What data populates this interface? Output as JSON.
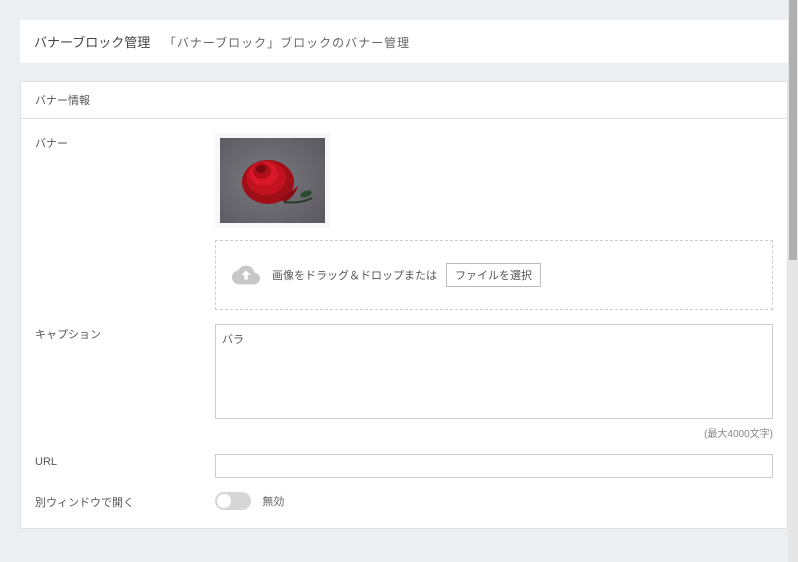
{
  "header": {
    "title": "バナーブロック管理",
    "sub": "「バナーブロック」ブロックのバナー管理"
  },
  "panel": {
    "title": "バナー情報"
  },
  "labels": {
    "banner": "バナー",
    "caption": "キャプション",
    "url": "URL",
    "newwindow": "別ウィンドウで開く"
  },
  "dropzone": {
    "text": "画像をドラッグ＆ドロップまたは",
    "button": "ファイルを選択"
  },
  "caption": {
    "value": "バラ",
    "hint": "(最大4000文字)"
  },
  "url": {
    "value": ""
  },
  "toggle": {
    "state_label": "無効"
  }
}
